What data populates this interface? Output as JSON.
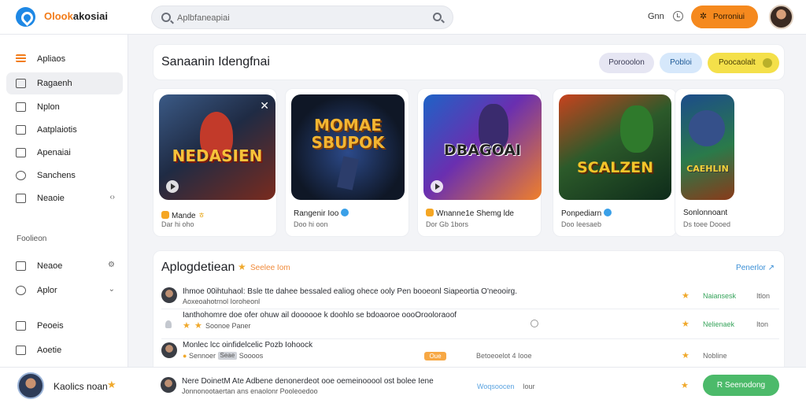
{
  "app": {
    "logo_prefix": "Olook",
    "logo_suffix": "akosiai",
    "search_placeholder": "Aplbfaneapiai",
    "top_link": "Gnn",
    "cta_label": "Porroniui",
    "icons": {
      "logo": "logo-icon",
      "search": "search-icon",
      "clock": "clock-icon",
      "cta": "puzzle-icon"
    }
  },
  "sidebar": {
    "items": [
      {
        "label": "Apliaos",
        "icon": "menu-icon"
      },
      {
        "label": "Ragaenh",
        "icon": "grid-icon",
        "active": true
      },
      {
        "label": "Nplon",
        "icon": "box-icon"
      },
      {
        "label": "Aatplaiotis",
        "icon": "list-icon"
      },
      {
        "label": "Apenaiai",
        "icon": "doc-icon"
      },
      {
        "label": "Sanchens",
        "icon": "user-icon"
      },
      {
        "label": "Neaoie",
        "icon": "list-icon",
        "chevron": "‹›"
      }
    ],
    "section_title": "Foolieon",
    "section_items": [
      {
        "label": "Neaoe",
        "icon": "box-icon",
        "chevron": "⚙"
      },
      {
        "label": "Aplor",
        "icon": "box-icon",
        "chevron": "⌄"
      },
      {
        "label": "Peoeis",
        "icon": "box-icon"
      },
      {
        "label": "Aoetie",
        "icon": "box-icon"
      }
    ]
  },
  "profile": {
    "name": "Kaolics noan",
    "star": "★"
  },
  "header": {
    "title": "Sanaanin Idengfnai",
    "pills": [
      "Porooolon",
      "Pobloi",
      "Poocaolalt"
    ]
  },
  "games": [
    {
      "art_title": "NEDASIEN",
      "name": "Mande",
      "name_suffix": "ㅎ",
      "sub": "Dar hi oho"
    },
    {
      "art_title": "MOMAE\nSBUPOK",
      "name": "Rangenir Ioo",
      "sub": "Doo hi oon"
    },
    {
      "art_title": "DBAGOAI",
      "name": "Wnanne1e Shemg lde",
      "sub": "Dor Gb 1bors"
    },
    {
      "art_title": "SCALZEN",
      "name": "Ponpediarn",
      "sub": "Doo Ieesaeb"
    },
    {
      "art_title": "CAEHLIN",
      "name": "Sonlonnoant",
      "sub": "Ds toee Dooed"
    }
  ],
  "activity": {
    "title": "Aplogdetiean",
    "tag": "Seelee Iom",
    "link": "Penerlor ↗",
    "rows": [
      {
        "line1": "Ihmoe 00ihtuhaol: Bsle tte dahee bessaled ealiog ohece ooly Pen booeonl Siapeortia O'neooirg.",
        "line2": "Aoxeoahotrnol Ioroheonl",
        "status": "Naiansesk",
        "tail": "Itlon"
      },
      {
        "line1": "Ianthohomre doe ofer ohuw ail doooooe k doohlo se bdoaoroe oooOrooloraoof",
        "line2": "Soonoe Paner",
        "status": "Nelienaek",
        "tail": "Iton"
      },
      {
        "line1": "Monlec lcc oinfidelcelic Pozb Iohoock",
        "line2": "Sennoer",
        "chip": "Seae",
        "line2_tail": "Soooos",
        "orange_chip": "Oue",
        "mid": "Betoeoelot 4 Iooe",
        "status": "Nobline"
      },
      {
        "line1": "Nere DoinetM Ate Adbene denonerdeot ooe oemeinooool ost bolee Iene",
        "line2": "Jonnonootaertan ans enaolonr Pooleoedoo",
        "mid": "Woqsoocen",
        "mid_tail": "Iour",
        "button": "R Seenodong"
      }
    ]
  },
  "colors": {
    "accent": "#f5891e",
    "brand": "#1e88e5",
    "green": "#4cba6a",
    "yellow_pill": "#f4e04a"
  }
}
